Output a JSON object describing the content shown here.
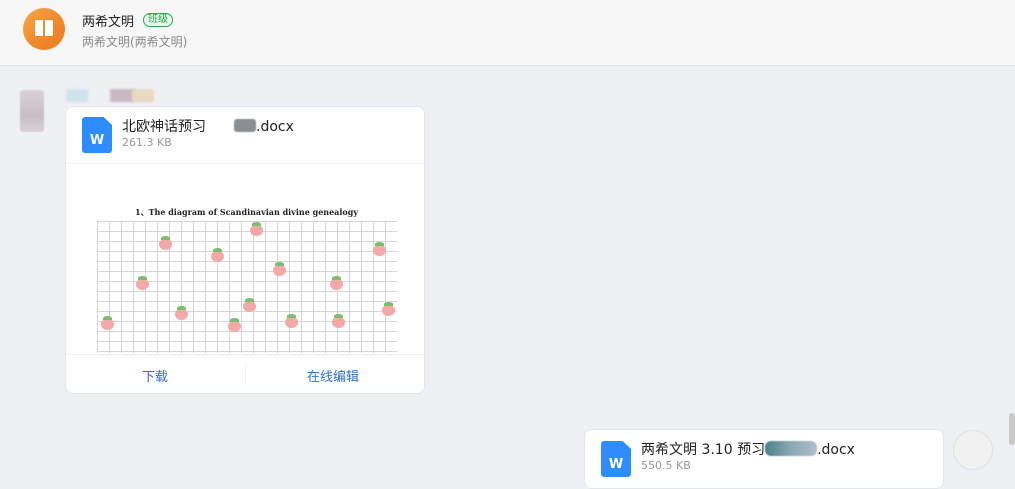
{
  "header": {
    "title": "两希文明",
    "badge": "班级",
    "subtitle": "两希文明(两希文明)"
  },
  "message1": {
    "file_name_prefix": "北欧神话预习",
    "file_name_suffix": ".docx",
    "file_size": "261.3 KB",
    "file_type_icon_letter": "W",
    "preview_heading": "1、The diagram of Scandinavian divine genealogy",
    "actions": {
      "download": "下载",
      "edit_online": "在线编辑"
    }
  },
  "message2": {
    "file_name_prefix": "两希文明 3.10 预习",
    "file_name_suffix": ".docx",
    "file_size": "550.5 KB",
    "file_type_icon_letter": "W"
  },
  "colors": {
    "accent_link": "#2f6fd7",
    "word_blue": "#2f8cff",
    "badge_green": "#28a745",
    "logo_orange": "#f08a2a"
  }
}
